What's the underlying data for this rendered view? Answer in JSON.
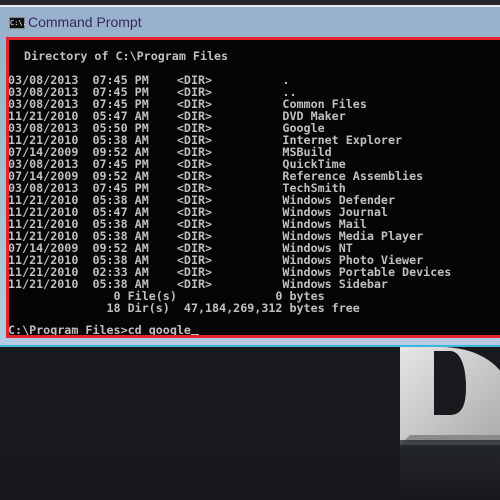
{
  "window": {
    "title": "Command Prompt",
    "icon": "console-icon",
    "icon_text": "C:\\."
  },
  "console": {
    "header": " Directory of C:\\Program Files",
    "entries": [
      {
        "date": "03/08/2013",
        "time": "07:45",
        "ampm": "PM",
        "type": "<DIR>",
        "name": "."
      },
      {
        "date": "03/08/2013",
        "time": "07:45",
        "ampm": "PM",
        "type": "<DIR>",
        "name": ".."
      },
      {
        "date": "03/08/2013",
        "time": "07:45",
        "ampm": "PM",
        "type": "<DIR>",
        "name": "Common Files"
      },
      {
        "date": "11/21/2010",
        "time": "05:47",
        "ampm": "AM",
        "type": "<DIR>",
        "name": "DVD Maker"
      },
      {
        "date": "03/08/2013",
        "time": "05:50",
        "ampm": "PM",
        "type": "<DIR>",
        "name": "Google"
      },
      {
        "date": "11/21/2010",
        "time": "05:38",
        "ampm": "AM",
        "type": "<DIR>",
        "name": "Internet Explorer"
      },
      {
        "date": "07/14/2009",
        "time": "09:52",
        "ampm": "AM",
        "type": "<DIR>",
        "name": "MSBuild"
      },
      {
        "date": "03/08/2013",
        "time": "07:45",
        "ampm": "PM",
        "type": "<DIR>",
        "name": "QuickTime"
      },
      {
        "date": "07/14/2009",
        "time": "09:52",
        "ampm": "AM",
        "type": "<DIR>",
        "name": "Reference Assemblies"
      },
      {
        "date": "03/08/2013",
        "time": "07:45",
        "ampm": "PM",
        "type": "<DIR>",
        "name": "TechSmith"
      },
      {
        "date": "11/21/2010",
        "time": "05:38",
        "ampm": "AM",
        "type": "<DIR>",
        "name": "Windows Defender"
      },
      {
        "date": "11/21/2010",
        "time": "05:47",
        "ampm": "AM",
        "type": "<DIR>",
        "name": "Windows Journal"
      },
      {
        "date": "11/21/2010",
        "time": "05:38",
        "ampm": "AM",
        "type": "<DIR>",
        "name": "Windows Mail"
      },
      {
        "date": "11/21/2010",
        "time": "05:38",
        "ampm": "AM",
        "type": "<DIR>",
        "name": "Windows Media Player"
      },
      {
        "date": "07/14/2009",
        "time": "09:52",
        "ampm": "AM",
        "type": "<DIR>",
        "name": "Windows NT"
      },
      {
        "date": "11/21/2010",
        "time": "05:38",
        "ampm": "AM",
        "type": "<DIR>",
        "name": "Windows Photo Viewer"
      },
      {
        "date": "11/21/2010",
        "time": "02:33",
        "ampm": "AM",
        "type": "<DIR>",
        "name": "Windows Portable Devices"
      },
      {
        "date": "11/21/2010",
        "time": "05:38",
        "ampm": "AM",
        "type": "<DIR>",
        "name": "Windows Sidebar"
      }
    ],
    "summary_files": "               0 File(s)              0 bytes",
    "summary_dirs": "              18 Dir(s)  47,184,269,312 bytes free",
    "prompt": "C:\\Program Files>",
    "command_input": "cd google"
  },
  "desktop": {
    "logo_letter": "D"
  },
  "colors": {
    "console_bg": "#050505",
    "console_text": "#c0c0c0",
    "highlight_border": "#e3232b",
    "titlebar_top": "#97b0cb",
    "titlebar_bottom": "#b4cbe3"
  }
}
